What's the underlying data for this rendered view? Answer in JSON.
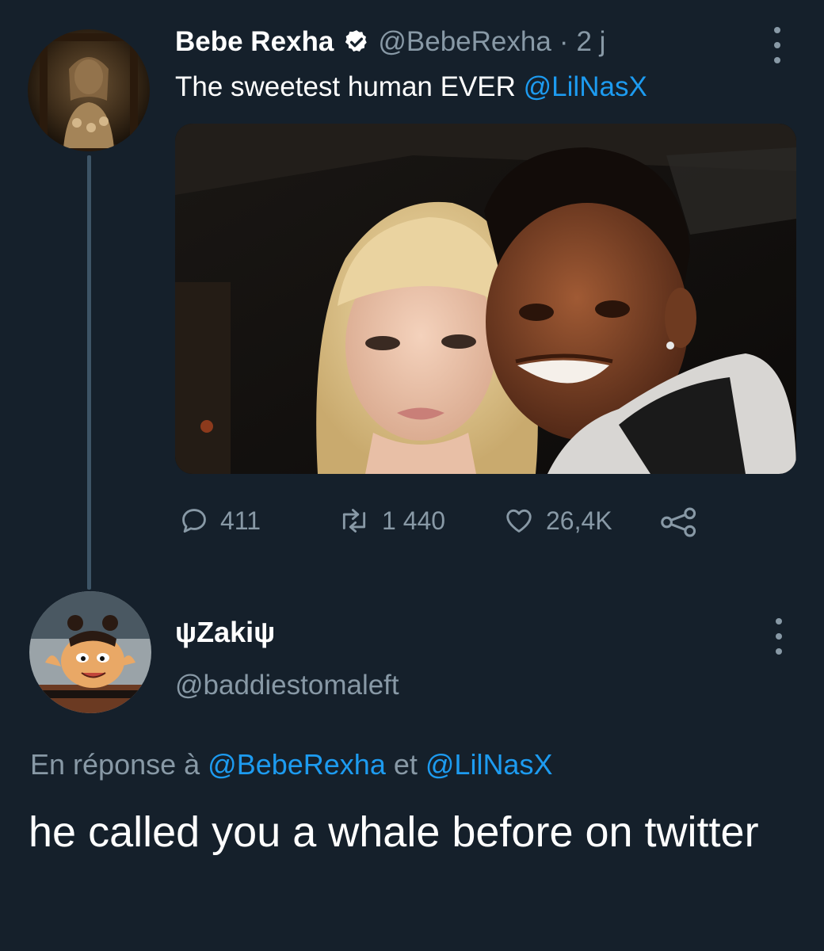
{
  "theme": {
    "background": "#15202b",
    "text_primary": "#ffffff",
    "text_secondary": "#8899a6",
    "accent": "#1d9bf0",
    "thread_line": "#3d5466"
  },
  "tweet": {
    "author_name": "Bebe Rexha",
    "verified_icon": "verified-badge-icon",
    "handle": "@BebeRexha",
    "separator": "·",
    "time": "2 j",
    "text": "The sweetest human EVER ",
    "mention": "@LilNasX",
    "menu_icon": "more-vertical-icon",
    "media_icon": "photo",
    "actions": {
      "replies": "411",
      "retweets": "1 440",
      "likes": "26,4K",
      "reply_icon": "reply-icon",
      "retweet_icon": "retweet-icon",
      "like_icon": "heart-icon",
      "share_icon": "share-icon"
    }
  },
  "reply": {
    "author_name": "ψZakiψ",
    "handle": "@baddiestomaleft",
    "menu_icon": "more-vertical-icon",
    "in_reply_prefix": "En réponse à ",
    "in_reply_user1": "@BebeRexha",
    "in_reply_connector": " et ",
    "in_reply_user2": "@LilNasX",
    "text": "he called you a whale before on twitter"
  }
}
